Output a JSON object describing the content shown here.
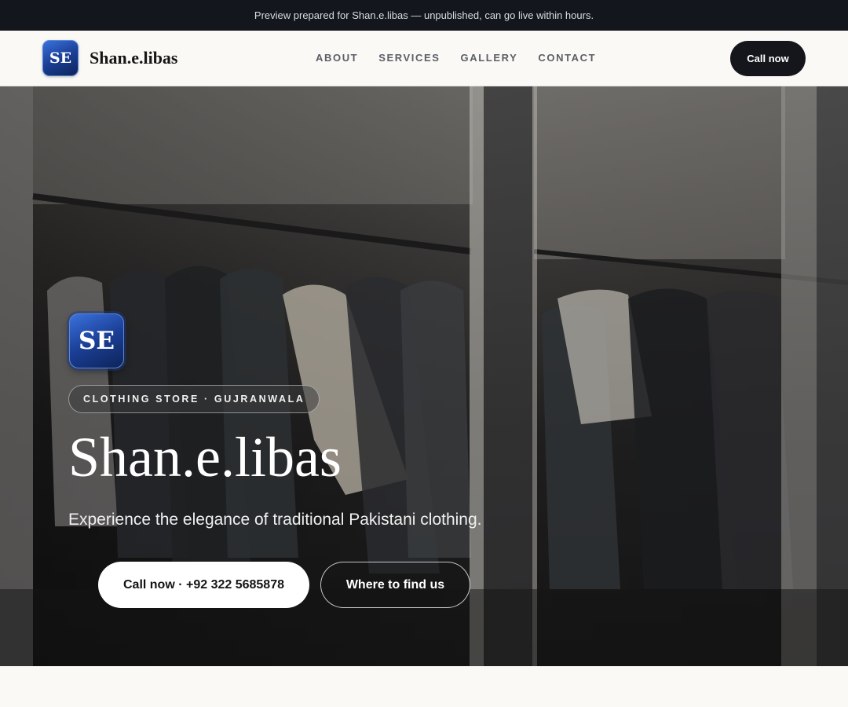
{
  "banner": {
    "text": "Preview prepared for Shan.e.libas — unpublished, can go live within hours."
  },
  "header": {
    "logo_initials": "SE",
    "brand_name": "Shan.e.libas",
    "nav_items": [
      {
        "label": "ABOUT"
      },
      {
        "label": "SERVICES"
      },
      {
        "label": "GALLERY"
      },
      {
        "label": "CONTACT"
      }
    ],
    "cta_label": "Call now"
  },
  "hero": {
    "logo_initials": "SE",
    "tag": "CLOTHING STORE · GUJRANWALA",
    "title": "Shan.e.libas",
    "subtitle": "Experience the elegance of traditional Pakistani clothing.",
    "primary_cta": "Call now · +92 322 5685878",
    "secondary_cta": "Where to find us",
    "background": "photo of clothes hanging on a rack behind a shop window"
  },
  "colors": {
    "banner_bg": "#13161c",
    "accent_dark": "#14161c",
    "logo_blue": "#1b3f96",
    "page_bg": "#faf9f6"
  }
}
